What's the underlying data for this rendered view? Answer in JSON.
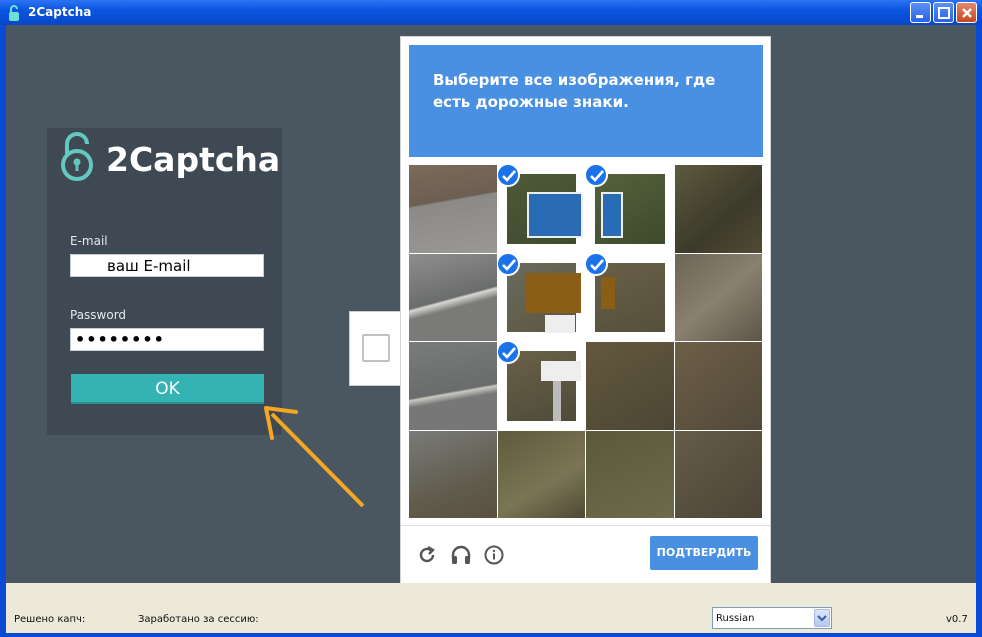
{
  "window": {
    "title": "2Captcha"
  },
  "login": {
    "logo_text": "2Captcha",
    "email_label": "E-mail",
    "email_value": "ваш E-mail",
    "password_label": "Password",
    "password_value": "••••••••",
    "ok_label": "OK"
  },
  "captcha": {
    "instruction_line1": "Выберите все изображения, где",
    "instruction_prefix": "есть ",
    "instruction_emphasis": "дорожные знаки",
    "instruction_suffix": ".",
    "verify_label": "ПОДТВЕРДИТЬ",
    "footer_icons": [
      "refresh-icon",
      "headphones-icon",
      "info-icon"
    ],
    "selected_tiles": [
      1,
      2,
      5,
      6,
      9
    ]
  },
  "statusbar": {
    "solved_label": "Решено капч:",
    "earned_label": "Заработано за сессию:",
    "language": "Russian",
    "version": "v0.7"
  },
  "colors": {
    "titlebar": "#0a55e0",
    "client_bg": "#4a5660",
    "panel_bg": "#3e4953",
    "ok_button": "#35b3b3",
    "captcha_blue": "#4a90e2",
    "arrow": "#f5a623"
  }
}
